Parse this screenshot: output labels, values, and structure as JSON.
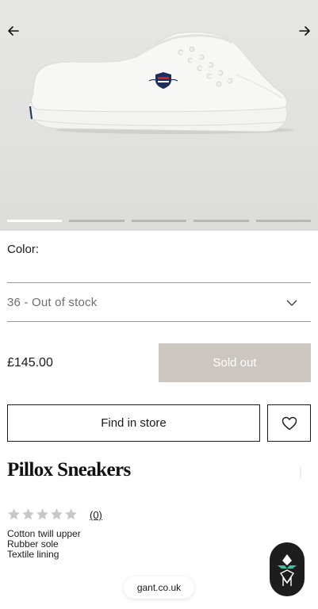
{
  "gallery": {
    "slide_count": 5,
    "active_slide": 1
  },
  "product": {
    "color_label": "Color:",
    "size_value": "36 - Out of stock",
    "price": "£145.00",
    "sold_out_label": "Sold out",
    "find_in_store_label": "Find in store",
    "name": "Pillox Sneakers",
    "rating": {
      "stars": 0,
      "max": 5,
      "count": "(0)"
    },
    "features": [
      "Cotton twill upper",
      "Rubber sole",
      "Textile lining"
    ]
  },
  "browser": {
    "url": "gant.co.uk"
  },
  "colors": {
    "sold_out_bg": "#cbc6bf",
    "star_empty": "#c8c8c8",
    "hero_bg": "#e3e3e1",
    "badge_bg": "#1d1d1d"
  },
  "icons": {
    "prev": "arrow-left-icon",
    "next": "arrow-right-icon",
    "dropdown": "chevron-down-icon",
    "wishlist": "heart-icon",
    "rating": "star-icon",
    "assistant": "assistant-logo-icon"
  }
}
